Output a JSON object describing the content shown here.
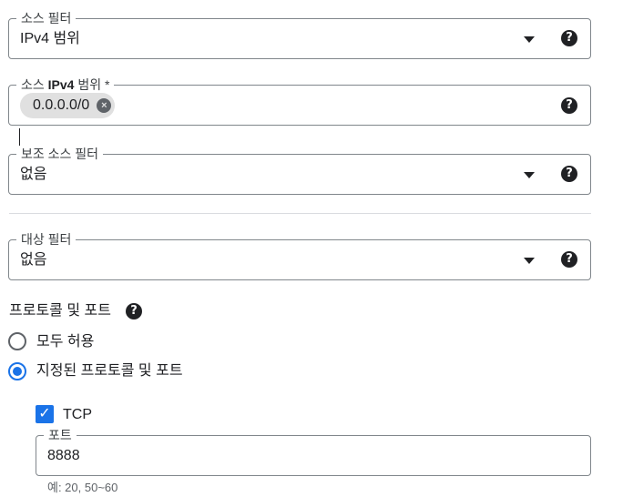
{
  "source_filter": {
    "label": "소스 필터",
    "value": "IPv4 범위"
  },
  "source_ipv4": {
    "label_prefix": "소스 ",
    "label_bold": "IPv4",
    "label_suffix": " 범위 *",
    "chip": "0.0.0.0/0"
  },
  "secondary_source_filter": {
    "label": "보조 소스 필터",
    "value": "없음"
  },
  "target_filter": {
    "label": "대상 필터",
    "value": "없음"
  },
  "protocols": {
    "title": "프로토콜 및 포트",
    "options": [
      {
        "label": "모두 허용",
        "selected": false
      },
      {
        "label": "지정된 프로토콜 및 포트",
        "selected": true
      }
    ],
    "tcp": {
      "label": "TCP",
      "checked": true
    },
    "port": {
      "label": "포트",
      "value": "8888",
      "hint": "예: 20, 50~60"
    }
  },
  "icons": {
    "help": "?",
    "dropdown": "arrow-drop-down",
    "chip_remove": "×",
    "check": "✓"
  },
  "colors": {
    "accent": "#1a73e8",
    "border": "#80868b",
    "text": "#202124",
    "chip_bg": "#e0e0e0"
  }
}
